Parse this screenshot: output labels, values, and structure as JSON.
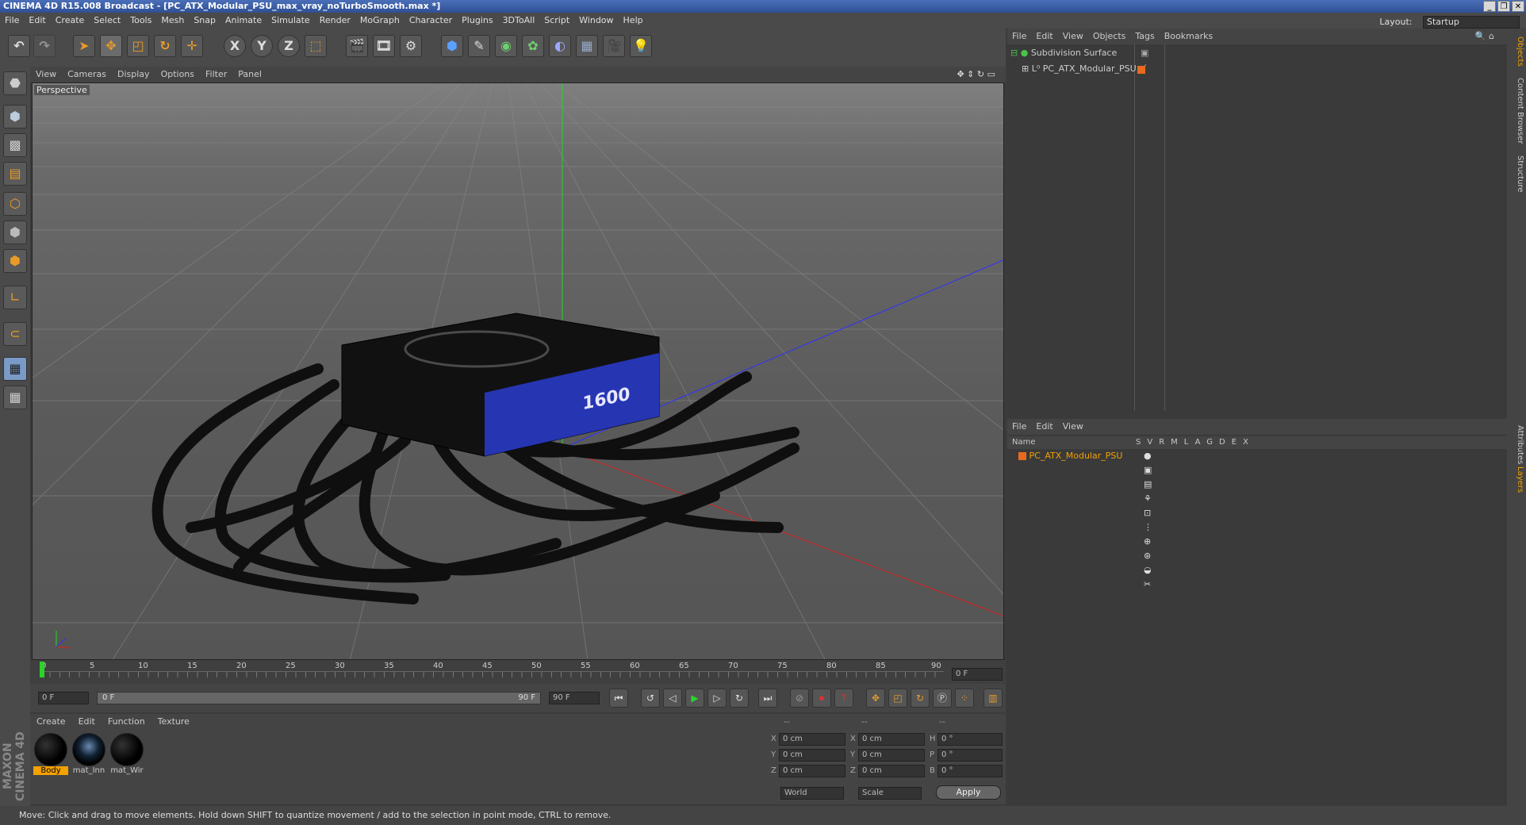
{
  "window": {
    "title": "CINEMA 4D R15.008 Broadcast - [PC_ATX_Modular_PSU_max_vray_noTurboSmooth.max *]",
    "controls": [
      "_",
      "❐",
      "✕"
    ]
  },
  "menu": [
    "File",
    "Edit",
    "Create",
    "Select",
    "Tools",
    "Mesh",
    "Snap",
    "Animate",
    "Simulate",
    "Render",
    "MoGraph",
    "Character",
    "Plugins",
    "3DToAll",
    "Script",
    "Window",
    "Help"
  ],
  "layout": {
    "label": "Layout:",
    "value": "Startup"
  },
  "toolbar": {
    "axis": [
      "X",
      "Y",
      "Z"
    ]
  },
  "viewport": {
    "menu": [
      "View",
      "Cameras",
      "Display",
      "Options",
      "Filter",
      "Panel"
    ],
    "label": "Perspective",
    "model_label": "1600"
  },
  "timeline": {
    "ticks": [
      "0",
      "5",
      "10",
      "15",
      "20",
      "25",
      "30",
      "35",
      "40",
      "45",
      "50",
      "55",
      "60",
      "65",
      "70",
      "75",
      "80",
      "85",
      "90"
    ],
    "frame_field": "0 F"
  },
  "transport": {
    "start": "0 F",
    "range_start": "0 F",
    "range_end": "90 F",
    "end": "90 F"
  },
  "materials": {
    "menu": [
      "Create",
      "Edit",
      "Function",
      "Texture"
    ],
    "items": [
      "Body",
      "mat_Inn",
      "mat_Wir"
    ]
  },
  "coords": {
    "rows": [
      {
        "a": "X",
        "v1": "0 cm",
        "b": "X",
        "v2": "0 cm",
        "c": "H",
        "v3": "0 °"
      },
      {
        "a": "Y",
        "v1": "0 cm",
        "b": "Y",
        "v2": "0 cm",
        "c": "P",
        "v3": "0 °"
      },
      {
        "a": "Z",
        "v1": "0 cm",
        "b": "Z",
        "v2": "0 cm",
        "c": "B",
        "v3": "0 °"
      }
    ],
    "world": "World",
    "scale": "Scale",
    "apply": "Apply",
    "header": [
      "--",
      "--",
      "--"
    ]
  },
  "objects": {
    "menu": [
      "File",
      "Edit",
      "View",
      "Objects",
      "Tags",
      "Bookmarks"
    ],
    "items": [
      "Subdivision Surface",
      "PC_ATX_Modular_PSU"
    ]
  },
  "layers": {
    "menu": [
      "File",
      "Edit",
      "View"
    ],
    "name_header": "Name",
    "cols": [
      "S",
      "V",
      "R",
      "M",
      "L",
      "A",
      "G",
      "D",
      "E",
      "X"
    ],
    "item": "PC_ATX_Modular_PSU"
  },
  "sidetabs": [
    "Objects",
    "Content Browser",
    "Structure",
    "Attributes",
    "Layers"
  ],
  "status": "Move: Click and drag to move elements. Hold down SHIFT to quantize movement / add to the selection in point mode, CTRL to remove.",
  "brand": "MAXON CINEMA 4D",
  "colors": {
    "accent": "#e89b2a",
    "selection": "#f2a100",
    "blue_stripe": "#2a3ccf"
  }
}
